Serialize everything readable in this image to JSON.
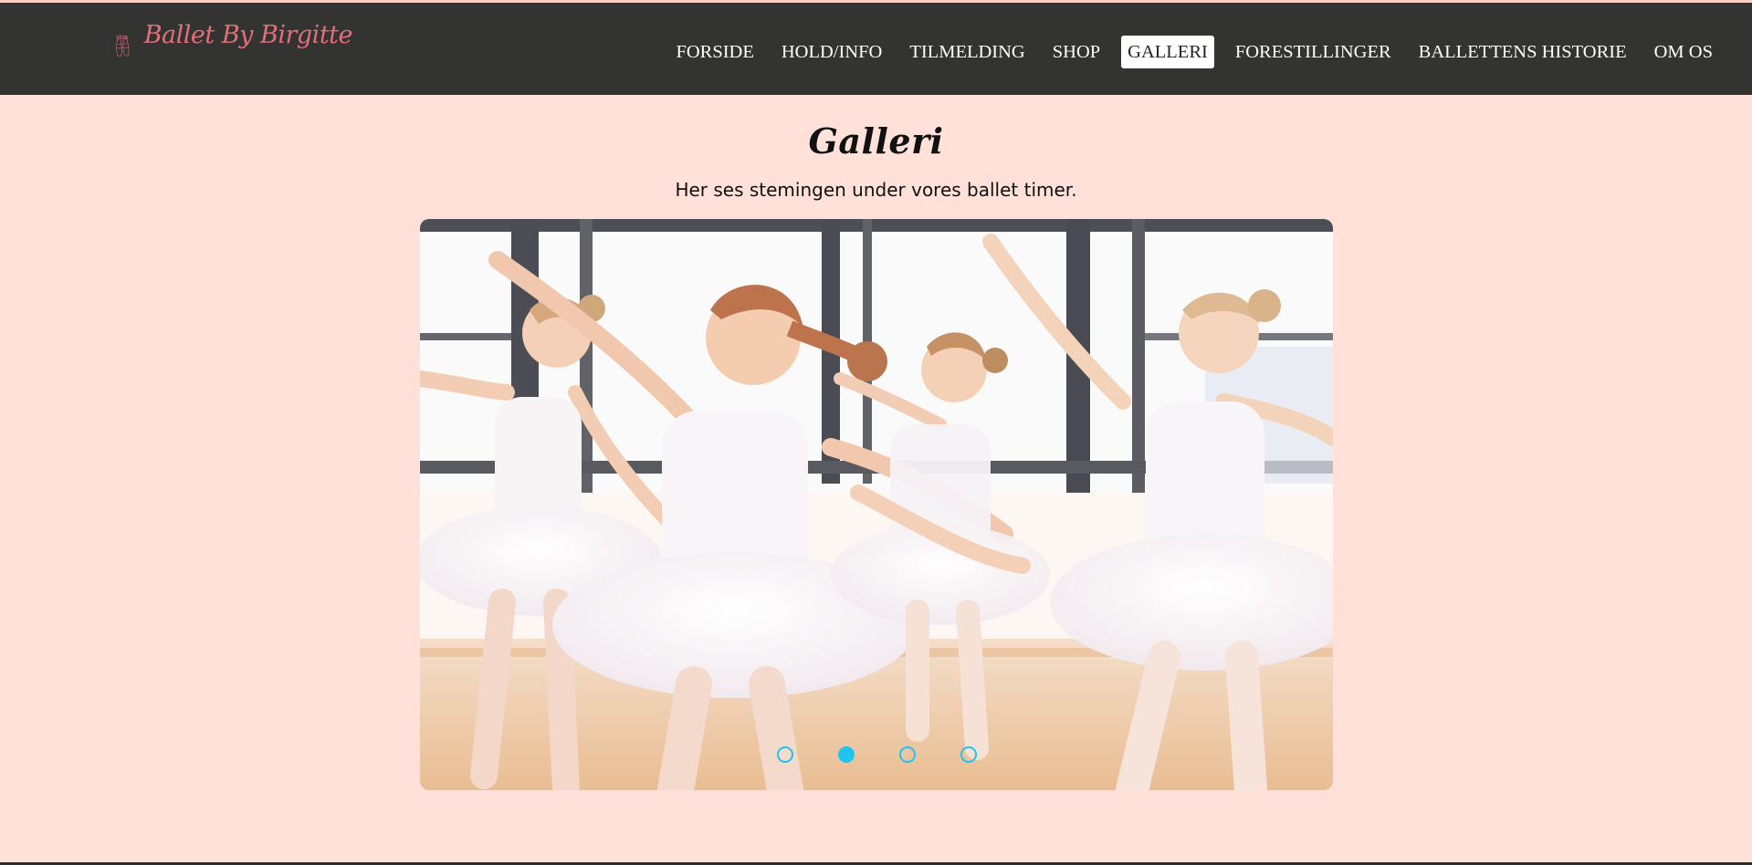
{
  "header": {
    "logo_text": "Ballet By Birgitte",
    "logo_color": "#e0707a",
    "background": "#333331"
  },
  "nav": {
    "items": [
      {
        "label": "FORSIDE"
      },
      {
        "label": "HOLD/INFO"
      },
      {
        "label": "TILMELDING"
      },
      {
        "label": "SHOP"
      },
      {
        "label": "GALLERI",
        "active": true
      },
      {
        "label": "FORESTILLINGER"
      },
      {
        "label": "BALLETTENS HISTORIE"
      },
      {
        "label": "OM OS"
      }
    ]
  },
  "main": {
    "title": "Galleri",
    "subtitle": "Her ses stemingen under vores ballet timer."
  },
  "carousel": {
    "image_alt": "",
    "slide_count": 4,
    "active_index": 1,
    "dot_color": "#1ec4f0"
  },
  "colors": {
    "page_background": "#ffe1da",
    "accent": "#1ec4f0"
  },
  "icons": {
    "logo": "ballet-shoes-icon"
  }
}
